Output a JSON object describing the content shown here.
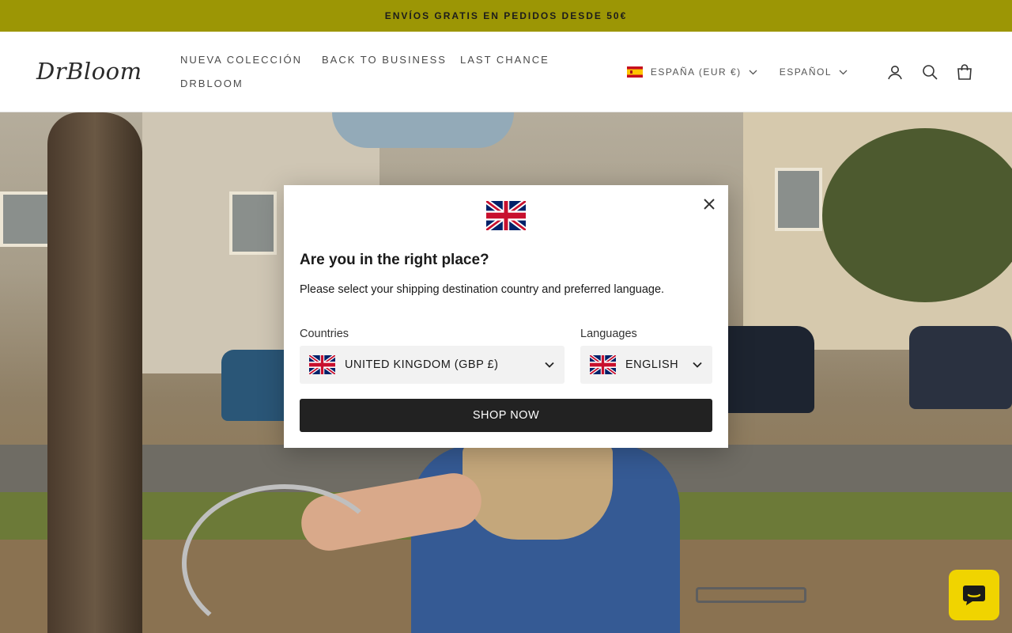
{
  "announcement": {
    "text": "ENVÍOS GRATIS EN PEDIDOS DESDE 50€"
  },
  "brand": {
    "logo_text_a": "Dr",
    "logo_text_b": "Bloom"
  },
  "nav": {
    "items": [
      {
        "label": "NUEVA COLECCIÓN"
      },
      {
        "label": "BACK TO BUSINESS"
      },
      {
        "label": "LAST CHANCE"
      },
      {
        "label": "DRBLOOM"
      }
    ]
  },
  "header": {
    "country_label": "ESPAÑA (EUR €)",
    "language_label": "ESPAÑOL",
    "icons": [
      "account-icon",
      "search-icon",
      "cart-icon"
    ]
  },
  "modal": {
    "title": "Are you in the right place?",
    "description": "Please select your shipping destination country and preferred language.",
    "countries_label": "Countries",
    "country_value": "UNITED KINGDOM (GBP £)",
    "languages_label": "Languages",
    "language_value": "ENGLISH",
    "button_label": "SHOP NOW"
  },
  "colors": {
    "announcement_bg": "#9c9605",
    "button_bg": "#222222",
    "chat_bg": "#f0d400"
  }
}
